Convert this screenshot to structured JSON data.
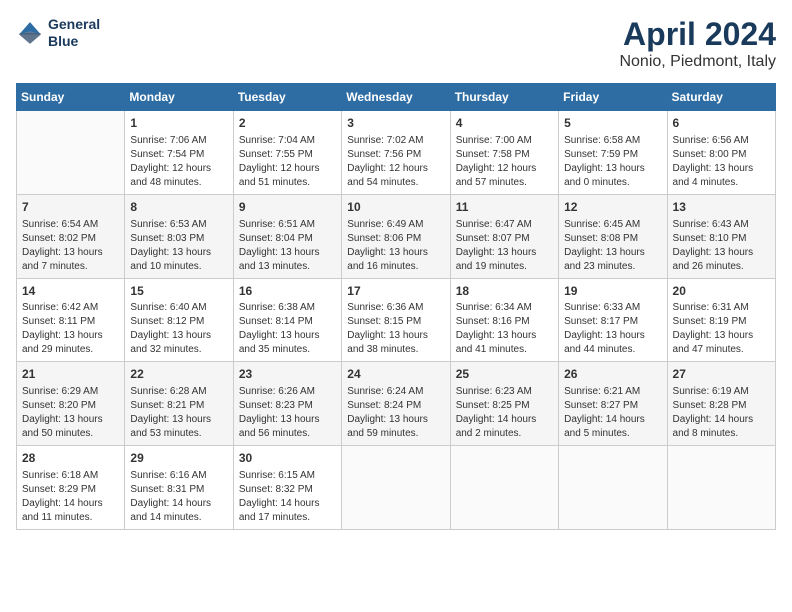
{
  "logo": {
    "line1": "General",
    "line2": "Blue"
  },
  "title": "April 2024",
  "location": "Nonio, Piedmont, Italy",
  "weekdays": [
    "Sunday",
    "Monday",
    "Tuesday",
    "Wednesday",
    "Thursday",
    "Friday",
    "Saturday"
  ],
  "weeks": [
    [
      {
        "day": "",
        "content": ""
      },
      {
        "day": "1",
        "sunrise": "7:06 AM",
        "sunset": "7:54 PM",
        "daylight": "12 hours and 48 minutes."
      },
      {
        "day": "2",
        "sunrise": "7:04 AM",
        "sunset": "7:55 PM",
        "daylight": "12 hours and 51 minutes."
      },
      {
        "day": "3",
        "sunrise": "7:02 AM",
        "sunset": "7:56 PM",
        "daylight": "12 hours and 54 minutes."
      },
      {
        "day": "4",
        "sunrise": "7:00 AM",
        "sunset": "7:58 PM",
        "daylight": "12 hours and 57 minutes."
      },
      {
        "day": "5",
        "sunrise": "6:58 AM",
        "sunset": "7:59 PM",
        "daylight": "13 hours and 0 minutes."
      },
      {
        "day": "6",
        "sunrise": "6:56 AM",
        "sunset": "8:00 PM",
        "daylight": "13 hours and 4 minutes."
      }
    ],
    [
      {
        "day": "7",
        "sunrise": "6:54 AM",
        "sunset": "8:02 PM",
        "daylight": "13 hours and 7 minutes."
      },
      {
        "day": "8",
        "sunrise": "6:53 AM",
        "sunset": "8:03 PM",
        "daylight": "13 hours and 10 minutes."
      },
      {
        "day": "9",
        "sunrise": "6:51 AM",
        "sunset": "8:04 PM",
        "daylight": "13 hours and 13 minutes."
      },
      {
        "day": "10",
        "sunrise": "6:49 AM",
        "sunset": "8:06 PM",
        "daylight": "13 hours and 16 minutes."
      },
      {
        "day": "11",
        "sunrise": "6:47 AM",
        "sunset": "8:07 PM",
        "daylight": "13 hours and 19 minutes."
      },
      {
        "day": "12",
        "sunrise": "6:45 AM",
        "sunset": "8:08 PM",
        "daylight": "13 hours and 23 minutes."
      },
      {
        "day": "13",
        "sunrise": "6:43 AM",
        "sunset": "8:10 PM",
        "daylight": "13 hours and 26 minutes."
      }
    ],
    [
      {
        "day": "14",
        "sunrise": "6:42 AM",
        "sunset": "8:11 PM",
        "daylight": "13 hours and 29 minutes."
      },
      {
        "day": "15",
        "sunrise": "6:40 AM",
        "sunset": "8:12 PM",
        "daylight": "13 hours and 32 minutes."
      },
      {
        "day": "16",
        "sunrise": "6:38 AM",
        "sunset": "8:14 PM",
        "daylight": "13 hours and 35 minutes."
      },
      {
        "day": "17",
        "sunrise": "6:36 AM",
        "sunset": "8:15 PM",
        "daylight": "13 hours and 38 minutes."
      },
      {
        "day": "18",
        "sunrise": "6:34 AM",
        "sunset": "8:16 PM",
        "daylight": "13 hours and 41 minutes."
      },
      {
        "day": "19",
        "sunrise": "6:33 AM",
        "sunset": "8:17 PM",
        "daylight": "13 hours and 44 minutes."
      },
      {
        "day": "20",
        "sunrise": "6:31 AM",
        "sunset": "8:19 PM",
        "daylight": "13 hours and 47 minutes."
      }
    ],
    [
      {
        "day": "21",
        "sunrise": "6:29 AM",
        "sunset": "8:20 PM",
        "daylight": "13 hours and 50 minutes."
      },
      {
        "day": "22",
        "sunrise": "6:28 AM",
        "sunset": "8:21 PM",
        "daylight": "13 hours and 53 minutes."
      },
      {
        "day": "23",
        "sunrise": "6:26 AM",
        "sunset": "8:23 PM",
        "daylight": "13 hours and 56 minutes."
      },
      {
        "day": "24",
        "sunrise": "6:24 AM",
        "sunset": "8:24 PM",
        "daylight": "13 hours and 59 minutes."
      },
      {
        "day": "25",
        "sunrise": "6:23 AM",
        "sunset": "8:25 PM",
        "daylight": "14 hours and 2 minutes."
      },
      {
        "day": "26",
        "sunrise": "6:21 AM",
        "sunset": "8:27 PM",
        "daylight": "14 hours and 5 minutes."
      },
      {
        "day": "27",
        "sunrise": "6:19 AM",
        "sunset": "8:28 PM",
        "daylight": "14 hours and 8 minutes."
      }
    ],
    [
      {
        "day": "28",
        "sunrise": "6:18 AM",
        "sunset": "8:29 PM",
        "daylight": "14 hours and 11 minutes."
      },
      {
        "day": "29",
        "sunrise": "6:16 AM",
        "sunset": "8:31 PM",
        "daylight": "14 hours and 14 minutes."
      },
      {
        "day": "30",
        "sunrise": "6:15 AM",
        "sunset": "8:32 PM",
        "daylight": "14 hours and 17 minutes."
      },
      {
        "day": "",
        "content": ""
      },
      {
        "day": "",
        "content": ""
      },
      {
        "day": "",
        "content": ""
      },
      {
        "day": "",
        "content": ""
      }
    ]
  ],
  "labels": {
    "sunrise": "Sunrise:",
    "sunset": "Sunset:",
    "daylight": "Daylight:"
  }
}
